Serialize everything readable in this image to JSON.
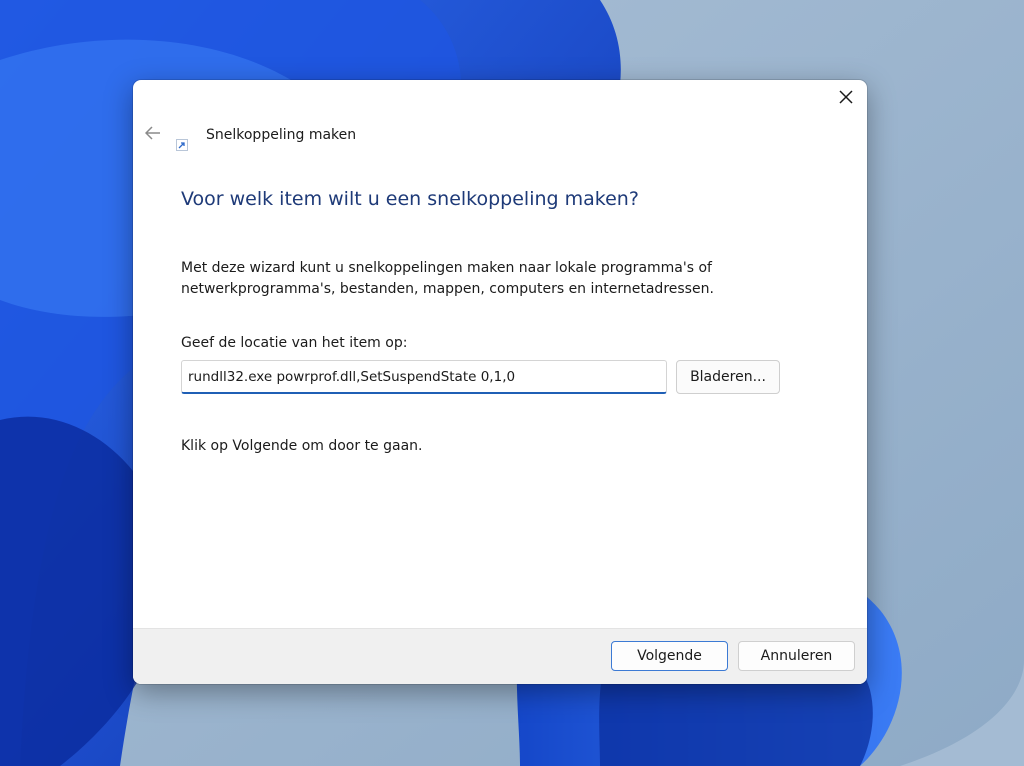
{
  "dialog": {
    "title": "Snelkoppeling maken",
    "heading": "Voor welk item wilt u een snelkoppeling maken?",
    "description": "Met deze wizard kunt u snelkoppelingen maken naar lokale programma's of netwerkprogramma's, bestanden, mappen, computers en internetadressen.",
    "location_label": "Geef de locatie van het item op:",
    "location_value": "rundll32.exe powrprof.dll,SetSuspendState 0,1,0",
    "browse_label": "Bladeren...",
    "hint": "Klik op Volgende om door te gaan.",
    "next_label": "Volgende",
    "cancel_label": "Annuleren"
  },
  "icons": {
    "close": "close-icon",
    "back": "back-arrow-icon",
    "wizard": "shortcut-icon"
  },
  "colors": {
    "heading": "#1e3a78",
    "accent": "#1f5fb5",
    "footer_bg": "#f0f0f0",
    "wallpaper_bg": "#9fb7d0",
    "wallpaper_bloom": "#1a4fd8"
  }
}
